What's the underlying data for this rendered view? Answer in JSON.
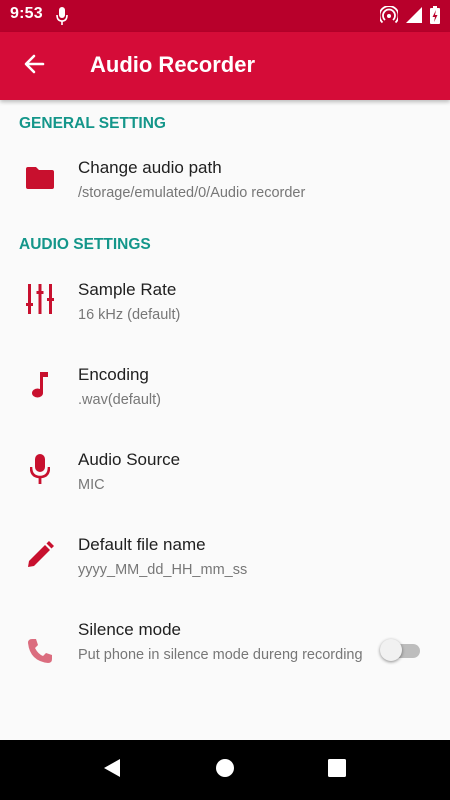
{
  "status_bar": {
    "time": "9:53",
    "icons": [
      "mic-icon",
      "hotspot-icon",
      "signal-icon",
      "battery-icon"
    ]
  },
  "app_bar": {
    "title": "Audio Recorder",
    "back_icon": "arrow-back-icon"
  },
  "colors": {
    "primary": "#d50c38",
    "primary_dark": "#b8002b",
    "accent": "#14968a",
    "icon": "#c8102e"
  },
  "sections": [
    {
      "header": "GENERAL SETTING",
      "items": [
        {
          "icon": "folder-icon",
          "title": "Change audio path",
          "summary": "/storage/emulated/0/Audio recorder"
        }
      ]
    },
    {
      "header": "AUDIO SETTINGS",
      "items": [
        {
          "icon": "equalizer-icon",
          "title": "Sample Rate",
          "summary": "16 kHz (default)"
        },
        {
          "icon": "music-note-icon",
          "title": "Encoding",
          "summary": ".wav(default)"
        },
        {
          "icon": "mic-icon",
          "title": "Audio Source",
          "summary": "MIC"
        },
        {
          "icon": "pencil-icon",
          "title": "Default file name",
          "summary": "yyyy_MM_dd_HH_mm_ss"
        },
        {
          "icon": "phone-icon",
          "title": "Silence mode",
          "summary": "Put phone in silence mode dureng recording",
          "toggle": false
        }
      ]
    }
  ],
  "nav_bar": {
    "buttons": [
      "back-triangle-icon",
      "home-circle-icon",
      "recents-square-icon"
    ]
  }
}
